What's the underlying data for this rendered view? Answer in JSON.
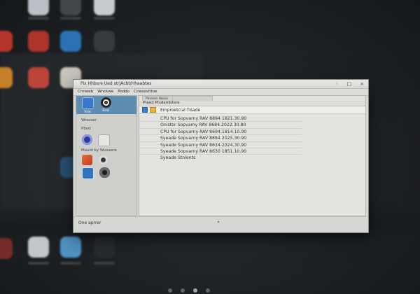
{
  "window": {
    "title": "Pix Hhbsre Ued strjAcbt/Hhaabtes",
    "controls": [
      "◦",
      "□",
      "×"
    ],
    "menu": [
      "Cnnweb",
      "Wnckwe",
      "Poddo",
      "Ccwsovittoe"
    ]
  },
  "sidebar": {
    "top_items": [
      {
        "label": "Vne",
        "icon": "monitor-icon",
        "color": "#3a78c9"
      },
      {
        "label": "Rsd",
        "icon": "target-icon",
        "color": "#ffffff"
      }
    ],
    "section_a": "Wrasser",
    "section_b": "Pbod",
    "section_c": "Mauid by Wusaere",
    "icons_row1": [
      {
        "icon": "disc-icon",
        "color": "#2b3d9a"
      },
      {
        "icon": "contacts-icon",
        "color": "#e8e6e0"
      }
    ],
    "icons_row2": [
      {
        "icon": "photo-icon",
        "color": "#c7352a"
      },
      {
        "icon": "camera-icon",
        "color": "#3a3a3a"
      }
    ],
    "icons_row3": [
      {
        "icon": "display-icon",
        "color": "#2f74c0"
      },
      {
        "icon": "webcam-icon",
        "color": "#1f1f1f"
      }
    ]
  },
  "content": {
    "tabs": [
      "Plnsose  Hasso",
      ""
    ],
    "panel_title": "Pteed Ptsdembtore",
    "selected_item": "Emproetcial Tisade",
    "rows": [
      "CPU for Sopvarny  RAV  8894 1821.30.80",
      "Onistor Sopvamy  RAV  8684.2022.30.80",
      "CPU for Sopvarny  RAV  8694.1814.10.90",
      "Syeade  Sopvarny  RAV  8894 2025.30.90",
      "Syeade  Sopvarny  RAV  8634.2024.30.90",
      "Syeade  Sopvarny  RAV  8630 1851.10.90",
      "Syeade  Stnlents"
    ]
  },
  "statusbar": {
    "text": "One aprrer"
  }
}
